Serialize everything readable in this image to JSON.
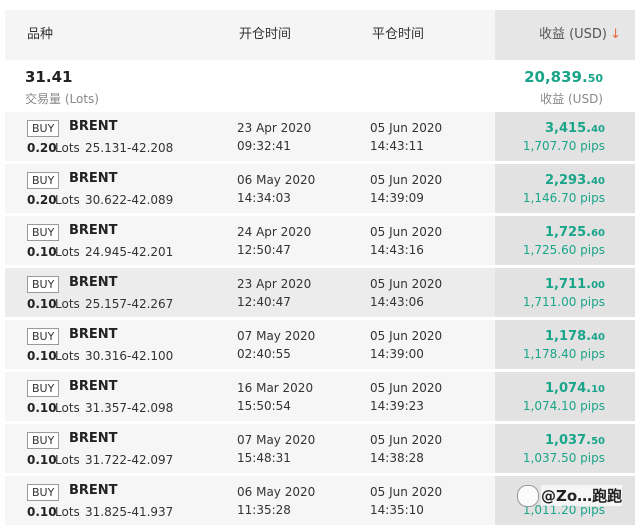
{
  "header": {
    "symbol": "品种",
    "open_time": "开仓时间",
    "close_time": "平仓时间",
    "profit": "收益 (USD)",
    "sort_icon": "arrow-down-icon"
  },
  "summary": {
    "total_lots": "31.41",
    "lots_label": "交易量 (Lots)",
    "total_profit_int": "20,839.",
    "total_profit_dec": "50",
    "profit_label": "收益 (USD)"
  },
  "rows": [
    {
      "type": "BUY",
      "symbol": "BRENT",
      "lots": "0.20",
      "unit": "Lots",
      "range": "25.131-42.208",
      "open_date": "23 Apr 2020",
      "open_time": "09:32:41",
      "close_date": "05 Jun 2020",
      "close_time": "14:43:11",
      "profit_int": "3,415.",
      "profit_dec": "40",
      "pips": "1,707.70 pips"
    },
    {
      "type": "BUY",
      "symbol": "BRENT",
      "lots": "0.20",
      "unit": "Lots",
      "range": "30.622-42.089",
      "open_date": "06 May 2020",
      "open_time": "14:34:03",
      "close_date": "05 Jun 2020",
      "close_time": "14:39:09",
      "profit_int": "2,293.",
      "profit_dec": "40",
      "pips": "1,146.70 pips"
    },
    {
      "type": "BUY",
      "symbol": "BRENT",
      "lots": "0.10",
      "unit": "Lots",
      "range": "24.945-42.201",
      "open_date": "24 Apr 2020",
      "open_time": "12:50:47",
      "close_date": "05 Jun 2020",
      "close_time": "14:43:16",
      "profit_int": "1,725.",
      "profit_dec": "60",
      "pips": "1,725.60 pips"
    },
    {
      "type": "BUY",
      "symbol": "BRENT",
      "lots": "0.10",
      "unit": "Lots",
      "range": "25.157-42.267",
      "open_date": "23 Apr 2020",
      "open_time": "12:40:47",
      "close_date": "05 Jun 2020",
      "close_time": "14:43:06",
      "profit_int": "1,711.",
      "profit_dec": "00",
      "pips": "1,711.00 pips"
    },
    {
      "type": "BUY",
      "symbol": "BRENT",
      "lots": "0.10",
      "unit": "Lots",
      "range": "30.316-42.100",
      "open_date": "07 May 2020",
      "open_time": "02:40:55",
      "close_date": "05 Jun 2020",
      "close_time": "14:39:00",
      "profit_int": "1,178.",
      "profit_dec": "40",
      "pips": "1,178.40 pips"
    },
    {
      "type": "BUY",
      "symbol": "BRENT",
      "lots": "0.10",
      "unit": "Lots",
      "range": "31.357-42.098",
      "open_date": "16 Mar 2020",
      "open_time": "15:50:54",
      "close_date": "05 Jun 2020",
      "close_time": "14:39:23",
      "profit_int": "1,074.",
      "profit_dec": "10",
      "pips": "1,074.10 pips"
    },
    {
      "type": "BUY",
      "symbol": "BRENT",
      "lots": "0.10",
      "unit": "Lots",
      "range": "31.722-42.097",
      "open_date": "07 May 2020",
      "open_time": "15:48:31",
      "close_date": "05 Jun 2020",
      "close_time": "14:38:28",
      "profit_int": "1,037.",
      "profit_dec": "50",
      "pips": "1,037.50 pips"
    },
    {
      "type": "BUY",
      "symbol": "BRENT",
      "lots": "0.10",
      "unit": "Lots",
      "range": "31.825-41.937",
      "open_date": "06 May 2020",
      "open_time": "11:35:28",
      "close_date": "05 Jun 2020",
      "close_time": "14:35:10",
      "profit_int": "",
      "profit_dec": "",
      "pips": "1,011.20 pips"
    }
  ],
  "watermark": {
    "text": "@Zo…跑跑"
  },
  "colors": {
    "profit": "#1aa58a",
    "sort_arrow": "#e8683a"
  }
}
